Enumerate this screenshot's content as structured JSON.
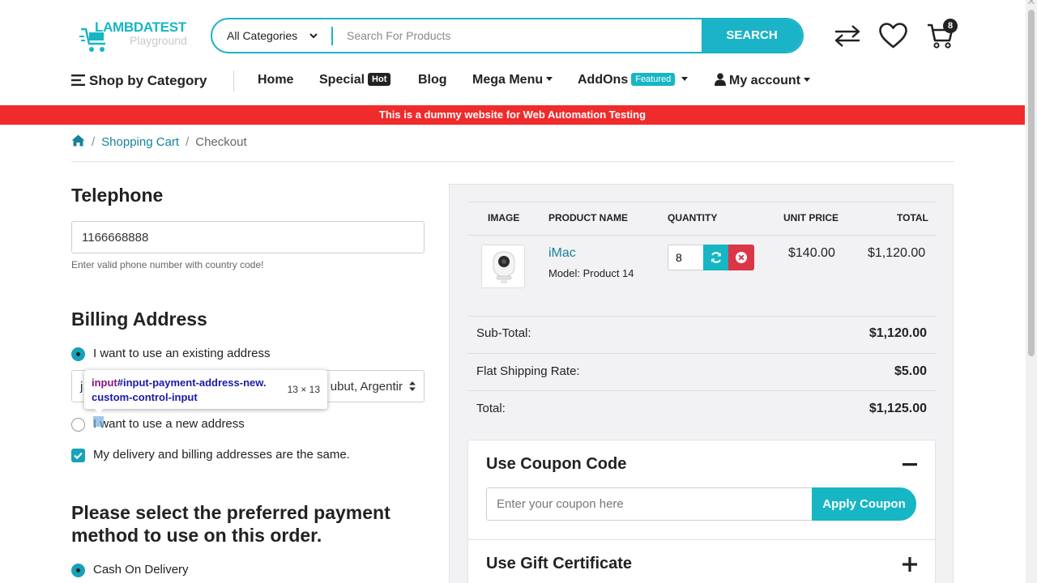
{
  "header": {
    "logo": {
      "brand": "LAMBDATEST",
      "sub": "Playground"
    },
    "search": {
      "category": "All Categories",
      "placeholder": "Search For Products",
      "button_label": "SEARCH"
    },
    "cart_count": "8"
  },
  "nav": {
    "shop_by_category": "Shop by Category",
    "home": "Home",
    "special": "Special",
    "special_tag": "Hot",
    "blog": "Blog",
    "mega_menu": "Mega Menu",
    "addons": "AddOns",
    "addons_tag": "Featured",
    "my_account": "My account"
  },
  "banner": "This is a dummy website for Web Automation Testing",
  "breadcrumb": {
    "cart": "Shopping Cart",
    "current": "Checkout"
  },
  "telephone": {
    "heading": "Telephone",
    "value": "1166668888",
    "help": "Enter valid phone number with country code!"
  },
  "billing": {
    "heading": "Billing Address",
    "existing_label": "I want to use an existing address",
    "selected_address_visible": "ubut, Argentir",
    "selected_address_lead": "j",
    "new_label": "I want to use a new address",
    "same_label": "My delivery and billing addresses are the same."
  },
  "inspector_tooltip": {
    "tag": "input",
    "id": "#input-payment-address-new.",
    "class": "custom-control-input",
    "size": "13 × 13"
  },
  "payment": {
    "heading_line1": "Please select the preferred payment",
    "heading_line2": "method to use on this order.",
    "cod_label": "Cash On Delivery"
  },
  "cart_table": {
    "headers": [
      "IMAGE",
      "PRODUCT NAME",
      "QUANTITY",
      "UNIT PRICE",
      "TOTAL"
    ],
    "rows": [
      {
        "name": "iMac",
        "model": "Model: Product 14",
        "quantity": "8",
        "unit_price": "$140.00",
        "total": "$1,120.00"
      }
    ]
  },
  "totals": [
    {
      "label": "Sub-Total:",
      "value": "$1,120.00"
    },
    {
      "label": "Flat Shipping Rate:",
      "value": "$5.00"
    },
    {
      "label": "Total:",
      "value": "$1,125.00"
    }
  ],
  "coupon": {
    "heading": "Use Coupon Code",
    "placeholder": "Enter your coupon here",
    "button": "Apply Coupon"
  },
  "gift": {
    "heading": "Use Gift Certificate"
  },
  "colors": {
    "accent": "#16b6c4",
    "banner": "#f02b2b",
    "danger": "#dc3545",
    "link": "#16839a"
  }
}
